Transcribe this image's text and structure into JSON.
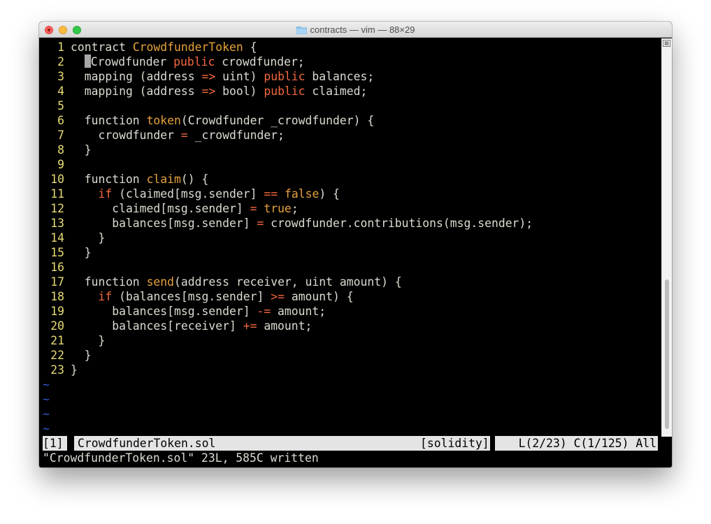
{
  "window": {
    "title": "contracts — vim — 88×29"
  },
  "editor": {
    "lines": [
      {
        "n": "1",
        "tokens": [
          {
            "t": "contract "
          },
          {
            "t": "CrowdfunderToken",
            "c": "fn"
          },
          {
            "t": " {"
          }
        ]
      },
      {
        "n": "2",
        "cursor": true,
        "tokens": [
          {
            "t": "Crowdfunder "
          },
          {
            "t": "public",
            "c": "kw"
          },
          {
            "t": " crowdfunder;"
          }
        ]
      },
      {
        "n": "3",
        "tokens": [
          {
            "t": "  mapping (address "
          },
          {
            "t": "=>",
            "c": "kw"
          },
          {
            "t": " uint) "
          },
          {
            "t": "public",
            "c": "kw"
          },
          {
            "t": " balances;"
          }
        ]
      },
      {
        "n": "4",
        "tokens": [
          {
            "t": "  mapping (address "
          },
          {
            "t": "=>",
            "c": "kw"
          },
          {
            "t": " bool) "
          },
          {
            "t": "public",
            "c": "kw"
          },
          {
            "t": " claimed;"
          }
        ]
      },
      {
        "n": "5",
        "tokens": []
      },
      {
        "n": "6",
        "tokens": [
          {
            "t": "  function "
          },
          {
            "t": "token",
            "c": "fn"
          },
          {
            "t": "(Crowdfunder _crowdfunder) {"
          }
        ]
      },
      {
        "n": "7",
        "tokens": [
          {
            "t": "    crowdfunder "
          },
          {
            "t": "=",
            "c": "kw"
          },
          {
            "t": " _crowdfunder;"
          }
        ]
      },
      {
        "n": "8",
        "tokens": [
          {
            "t": "  }"
          }
        ]
      },
      {
        "n": "9",
        "tokens": []
      },
      {
        "n": "10",
        "tokens": [
          {
            "t": "  function "
          },
          {
            "t": "claim",
            "c": "fn"
          },
          {
            "t": "() {"
          }
        ]
      },
      {
        "n": "11",
        "tokens": [
          {
            "t": "    "
          },
          {
            "t": "if",
            "c": "kw"
          },
          {
            "t": " (claimed[msg.sender] "
          },
          {
            "t": "==",
            "c": "kw"
          },
          {
            "t": " "
          },
          {
            "t": "false",
            "c": "fn"
          },
          {
            "t": ") {"
          }
        ]
      },
      {
        "n": "12",
        "tokens": [
          {
            "t": "      claimed[msg.sender] "
          },
          {
            "t": "=",
            "c": "kw"
          },
          {
            "t": " "
          },
          {
            "t": "true",
            "c": "fn"
          },
          {
            "t": ";"
          }
        ]
      },
      {
        "n": "13",
        "tokens": [
          {
            "t": "      balances[msg.sender] "
          },
          {
            "t": "=",
            "c": "kw"
          },
          {
            "t": " crowdfunder.contributions(msg.sender);"
          }
        ]
      },
      {
        "n": "14",
        "tokens": [
          {
            "t": "    }"
          }
        ]
      },
      {
        "n": "15",
        "tokens": [
          {
            "t": "  }"
          }
        ]
      },
      {
        "n": "16",
        "tokens": []
      },
      {
        "n": "17",
        "tokens": [
          {
            "t": "  function "
          },
          {
            "t": "send",
            "c": "fn"
          },
          {
            "t": "(address receiver, uint amount) {"
          }
        ]
      },
      {
        "n": "18",
        "tokens": [
          {
            "t": "    "
          },
          {
            "t": "if",
            "c": "kw"
          },
          {
            "t": " (balances[msg.sender] "
          },
          {
            "t": ">=",
            "c": "kw"
          },
          {
            "t": " amount) {"
          }
        ]
      },
      {
        "n": "19",
        "tokens": [
          {
            "t": "      balances[msg.sender] "
          },
          {
            "t": "-=",
            "c": "kw"
          },
          {
            "t": " amount;"
          }
        ]
      },
      {
        "n": "20",
        "tokens": [
          {
            "t": "      balances[receiver] "
          },
          {
            "t": "+=",
            "c": "kw"
          },
          {
            "t": " amount;"
          }
        ]
      },
      {
        "n": "21",
        "tokens": [
          {
            "t": "    }"
          }
        ]
      },
      {
        "n": "22",
        "tokens": [
          {
            "t": "  }"
          }
        ]
      },
      {
        "n": "23",
        "tokens": [
          {
            "t": "}"
          }
        ]
      }
    ],
    "tilde": "~",
    "tilde_count": 4
  },
  "statusline": {
    "buffer": "[1]",
    "filename": "CrowdfunderToken.sol",
    "filetype": "[solidity]",
    "position": "L(2/23) C(1/125) All"
  },
  "cmdline": {
    "message": "\"CrowdfunderToken.sol\" 23L, 585C written"
  },
  "colors": {
    "keyword": "#f3683e",
    "function": "#e6a23c",
    "line_number": "#e6db74",
    "text": "#dcdcd2",
    "tilde": "#2f5fd4"
  },
  "icons": {
    "title": "folder-icon",
    "scrollbar": "menu-icon"
  }
}
